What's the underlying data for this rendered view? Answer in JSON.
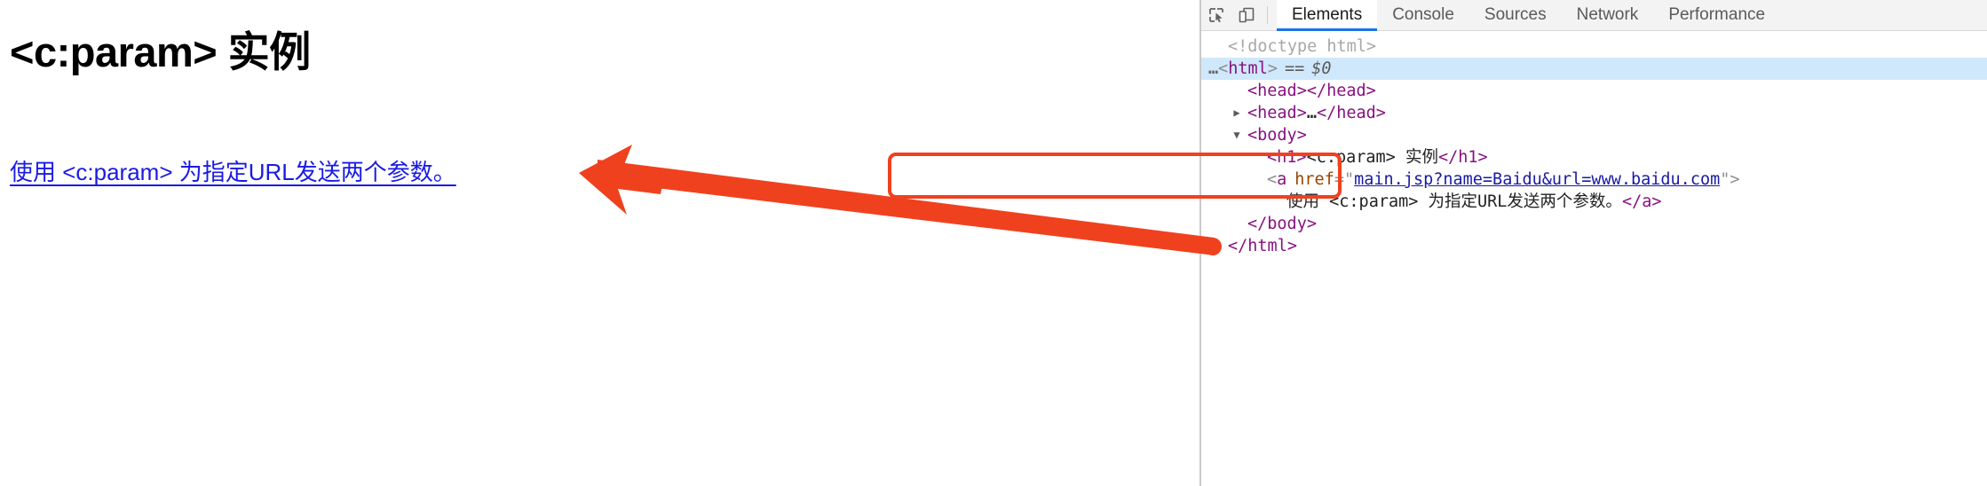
{
  "page": {
    "title": "<c:param> 实例",
    "link_text": "使用 <c:param> 为指定URL发送两个参数。"
  },
  "devtools": {
    "toolbar": {
      "inspect_icon": "inspect-element-icon",
      "device_icon": "device-toolbar-icon"
    },
    "tabs": [
      {
        "label": "Elements",
        "active": true
      },
      {
        "label": "Console",
        "active": false
      },
      {
        "label": "Sources",
        "active": false
      },
      {
        "label": "Network",
        "active": false
      },
      {
        "label": "Performance",
        "active": false
      }
    ],
    "dom": {
      "doctype": "<!doctype html>",
      "html_dots": "…",
      "html_open_lt": "<",
      "html_tag": "html",
      "html_open_gt": ">",
      "html_eq": "==",
      "html_dollar": "$0",
      "head_empty_open": "<head>",
      "head_empty_close": "</head>",
      "head_collapsed_open": "<head>",
      "head_collapsed_ellipsis": "…",
      "head_collapsed_close": "</head>",
      "body_open": "<body>",
      "h1_open": "<h1>",
      "h1_text": "<c:param> 实例",
      "h1_close": "</h1>",
      "a_open_lt": "<",
      "a_tag": "a",
      "a_attr_name": "href",
      "a_attr_eq": "=",
      "a_quote": "\"",
      "a_attr_value": "main.jsp?name=Baidu&url=www.baidu.com",
      "a_open_gt": ">",
      "a_text": "使用 <c:param> 为指定URL发送两个参数。",
      "a_close": "</a>",
      "body_close": "</body>",
      "html_close": "</html>",
      "twisty_closed": "▶",
      "twisty_open": "▼"
    }
  },
  "annotations": {
    "highlight_box_color": "#f0411f",
    "arrow_color": "#f0411f",
    "arrow_direction": "points-left-to-page-link"
  },
  "colors": {
    "link_blue": "#1a1ae6",
    "tab_accent": "#1a73e8",
    "selected_row": "#cfe8fc",
    "tag_purple": "#881280",
    "attr_orange": "#994500",
    "attr_value_blue": "#1a1aa6"
  }
}
